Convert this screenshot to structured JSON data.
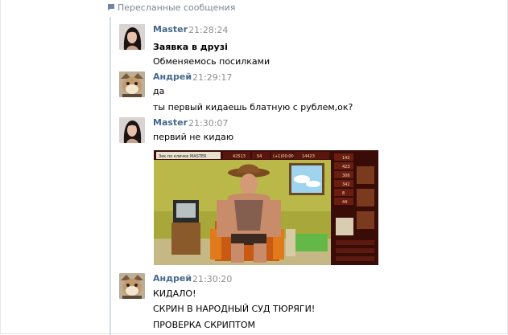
{
  "header": {
    "label": "Пересланные сообщения",
    "icon": "forward-message-icon"
  },
  "messages": [
    {
      "author": "Master",
      "time": "21:28:24",
      "lines": [
        "Заявка в друзі",
        "Обменяемось посилками"
      ]
    },
    {
      "author": "Андрей",
      "time": "21:29:17",
      "lines": [
        "да",
        "ты первый кидаешь блатную с рублем,ок?"
      ]
    },
    {
      "author": "Master",
      "time": "21:30:07",
      "lines": [
        "первий не кидаю"
      ]
    },
    {
      "author": "Андрей",
      "time": "21:30:20",
      "lines": [
        "КИДАЛО!",
        "СКРИН В НАРОДНЫЙ СУД ТЮРЯГИ!",
        "ПРОВЕРКА СКРИПТОМ"
      ]
    }
  ],
  "attachment": {
    "game_stats": [
      "42513",
      "54",
      "(+1)00:00",
      "14423",
      "142",
      "423",
      "306",
      "342",
      "8",
      "44"
    ],
    "game_field": "Зек по кличке MASTER"
  },
  "colors": {
    "author": "#45688e",
    "time": "#8f8f8f",
    "header": "#7b8594",
    "rule": "#d6dde6"
  }
}
